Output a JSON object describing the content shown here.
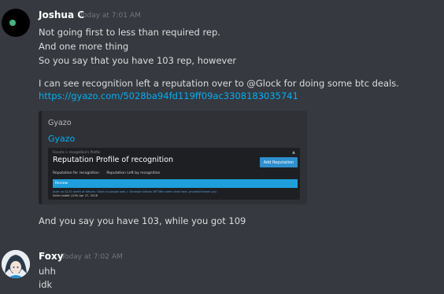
{
  "messages": [
    {
      "username": "Joshua C",
      "timestamp": "Today at 7:01 AM",
      "lines": [
        "Not going first to less than required rep.",
        "And one more thing",
        "So you say that you have 103 rep, however",
        "I can see recognition left a reputation over to @Glock for doing some btc deals.",
        "And you say you have 103, while you got 109"
      ],
      "link": "https://gyazo.com/5028ba94fd119ff09ac3308183035741",
      "embed": {
        "provider": "Gyazo",
        "title": "Gyazo",
        "screenshot": {
          "breadcrumb": "Forums  >  recognition's Profile",
          "page_title": "Reputation Profile of recognition",
          "add_button": "Add Reputation",
          "tabs": [
            "Reputation for recognition",
            "Reputation Left by recognition"
          ],
          "review_label": "Review",
          "review_text": "Jude: as $120 worth of bitcoin. Glock to paypal was = Stronger bitcoin 6FT.We came cleat here, proved/d thank you",
          "review_meta": "Seller  Jabbit (109)  Apr 27, 2018"
        }
      }
    },
    {
      "username": "Foxy",
      "timestamp": "Today at 7:02 AM",
      "lines": [
        "uhh",
        "idk"
      ]
    }
  ]
}
